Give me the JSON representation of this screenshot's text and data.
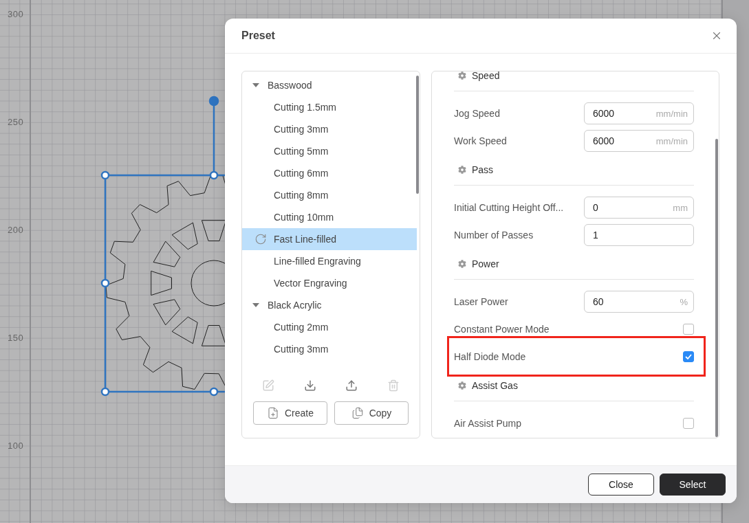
{
  "ruler": {
    "labels": [
      "300",
      "250",
      "200",
      "150",
      "100"
    ]
  },
  "dialog": {
    "title": "Preset",
    "tree": [
      {
        "label": "Basswood",
        "expanded": true,
        "children": [
          {
            "label": "Cutting 1.5mm",
            "selected": false,
            "syncing": false
          },
          {
            "label": "Cutting 3mm",
            "selected": false,
            "syncing": false
          },
          {
            "label": "Cutting 5mm",
            "selected": false,
            "syncing": false
          },
          {
            "label": "Cutting 6mm",
            "selected": false,
            "syncing": false
          },
          {
            "label": "Cutting 8mm",
            "selected": false,
            "syncing": false
          },
          {
            "label": "Cutting 10mm",
            "selected": false,
            "syncing": false
          },
          {
            "label": "Fast Line-filled",
            "selected": true,
            "syncing": true
          },
          {
            "label": "Line-filled Engraving",
            "selected": false,
            "syncing": false
          },
          {
            "label": "Vector Engraving",
            "selected": false,
            "syncing": false
          }
        ]
      },
      {
        "label": "Black Acrylic",
        "expanded": true,
        "children": [
          {
            "label": "Cutting 2mm",
            "selected": false,
            "syncing": false
          },
          {
            "label": "Cutting 3mm",
            "selected": false,
            "syncing": false
          }
        ]
      }
    ],
    "tools": [
      {
        "kind": "edit",
        "disabled": true
      },
      {
        "kind": "import",
        "disabled": false
      },
      {
        "kind": "export",
        "disabled": false
      },
      {
        "kind": "delete",
        "disabled": true
      }
    ],
    "actions": [
      {
        "kind": "create",
        "label": "Create"
      },
      {
        "kind": "copy",
        "label": "Copy"
      }
    ],
    "sections": [
      {
        "title": "Speed",
        "rows": [
          {
            "kind": "input",
            "label": "Jog Speed",
            "value": "6000",
            "unit": "mm/min"
          },
          {
            "kind": "input",
            "label": "Work Speed",
            "value": "6000",
            "unit": "mm/min"
          }
        ]
      },
      {
        "title": "Pass",
        "rows": [
          {
            "kind": "input",
            "label": "Initial Cutting Height Off...",
            "value": "0",
            "unit": "mm"
          },
          {
            "kind": "input",
            "label": "Number of Passes",
            "value": "1"
          }
        ]
      },
      {
        "title": "Power",
        "rows": [
          {
            "kind": "input",
            "label": "Laser Power",
            "value": "60",
            "unit": "%"
          },
          {
            "kind": "checkbox",
            "label": "Constant Power Mode",
            "checked": false,
            "highlighted": false
          },
          {
            "kind": "checkbox",
            "label": "Half Diode Mode",
            "checked": true,
            "highlighted": true
          }
        ]
      },
      {
        "title": "Assist Gas",
        "rows": [
          {
            "kind": "checkbox",
            "label": "Air Assist Pump",
            "checked": false,
            "highlighted": false
          }
        ]
      }
    ],
    "buttons": [
      {
        "kind": "secondary",
        "label": "Close"
      },
      {
        "kind": "primary",
        "label": "Select"
      }
    ]
  }
}
